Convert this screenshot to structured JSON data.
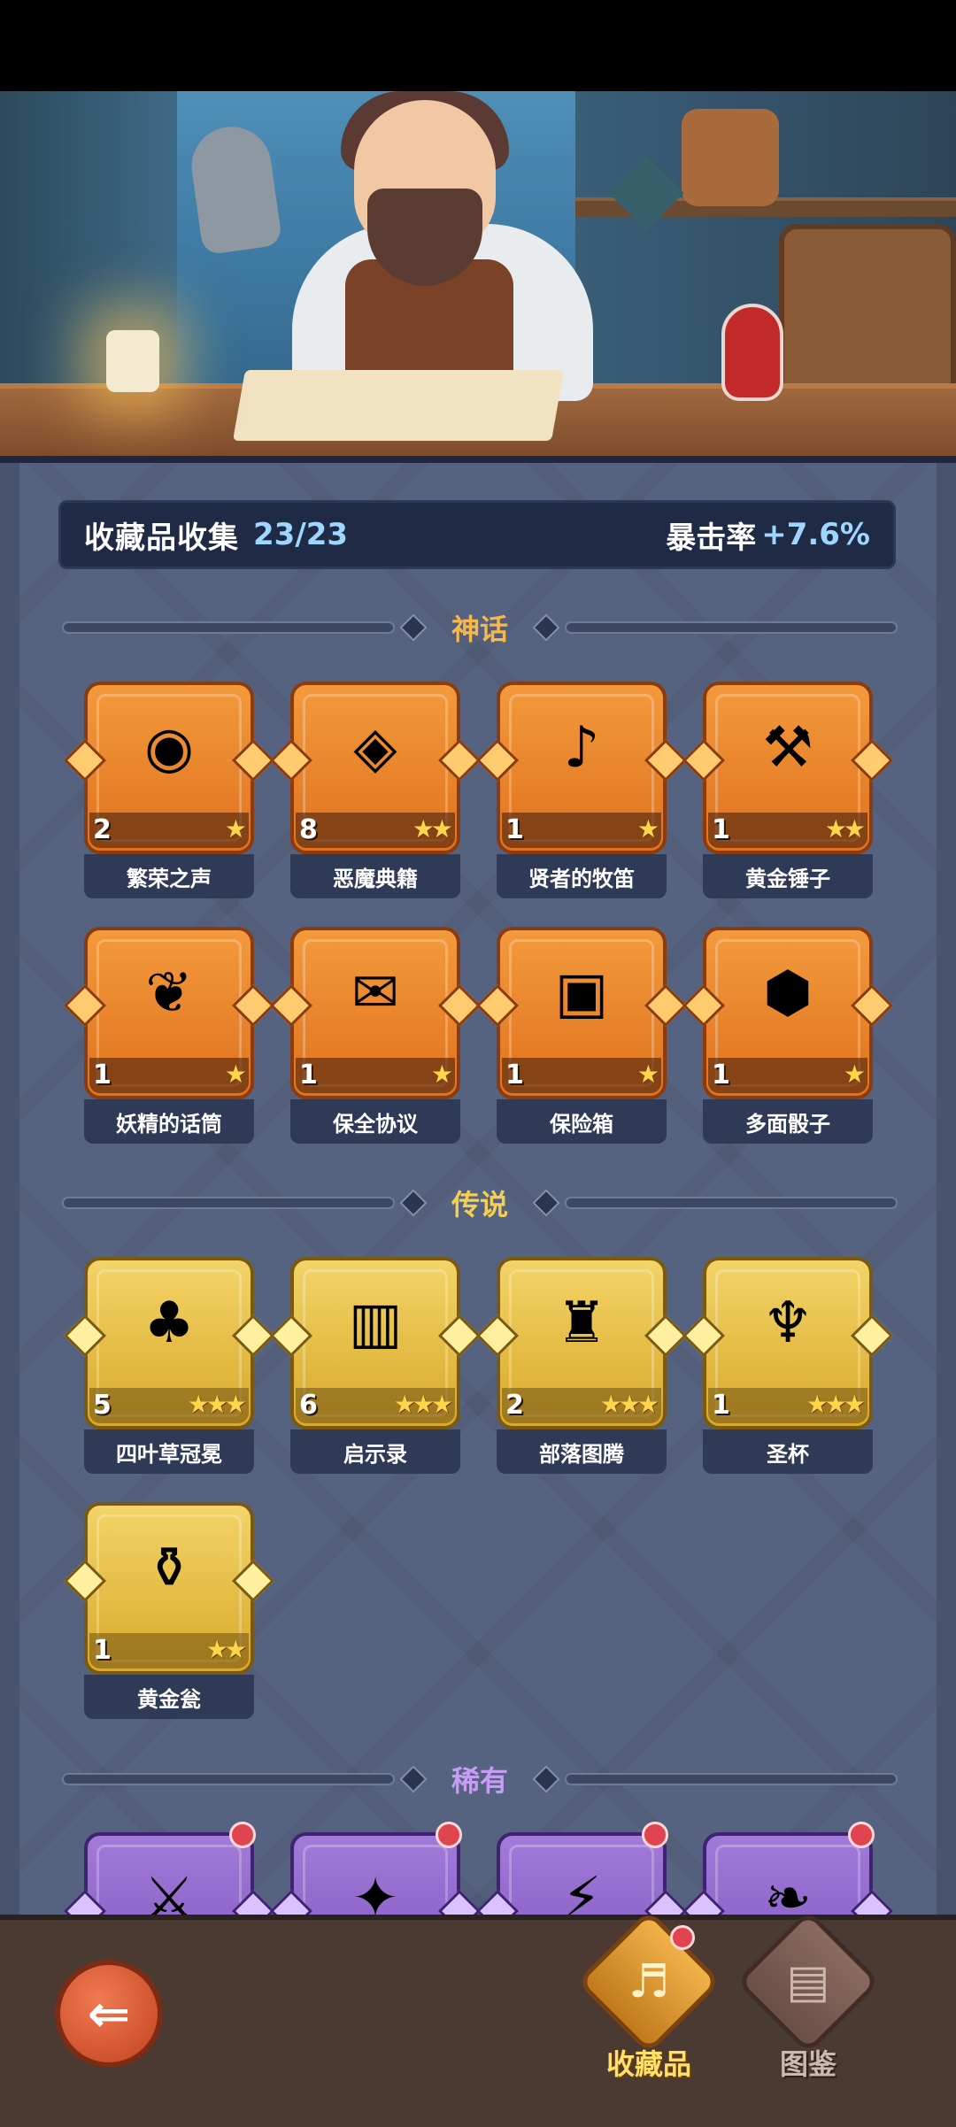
{
  "summary": {
    "label": "收藏品收集",
    "count": "23/23",
    "crit_label": "暴击率",
    "crit_value": "+7.6%"
  },
  "sections": {
    "mythic": {
      "title": "神话",
      "color": "#f6b84a"
    },
    "legendary": {
      "title": "传说",
      "color": "#f4cf52"
    },
    "rare": {
      "title": "稀有",
      "color": "#c79cf5"
    }
  },
  "mythic_items": [
    {
      "name": "繁荣之声",
      "level": "2",
      "stars": "★",
      "icon": "orb-icon"
    },
    {
      "name": "恶魔典籍",
      "level": "8",
      "stars": "★★",
      "icon": "eye-book-icon"
    },
    {
      "name": "贤者的牧笛",
      "level": "1",
      "stars": "★",
      "icon": "flute-icon"
    },
    {
      "name": "黄金锤子",
      "level": "1",
      "stars": "★★",
      "icon": "hammer-icon"
    },
    {
      "name": "妖精的话筒",
      "level": "1",
      "stars": "★",
      "icon": "fairy-icon"
    },
    {
      "name": "保全协议",
      "level": "1",
      "stars": "★",
      "icon": "scroll-icon"
    },
    {
      "name": "保险箱",
      "level": "1",
      "stars": "★",
      "icon": "safe-icon"
    },
    {
      "name": "多面骰子",
      "level": "1",
      "stars": "★",
      "icon": "dice-icon"
    }
  ],
  "legendary_items": [
    {
      "name": "四叶草冠冕",
      "level": "5",
      "stars": "★★★",
      "icon": "clover-crown-icon"
    },
    {
      "name": "启示录",
      "level": "6",
      "stars": "★★★",
      "icon": "open-book-icon"
    },
    {
      "name": "部落图腾",
      "level": "2",
      "stars": "★★★",
      "icon": "totem-icon"
    },
    {
      "name": "圣杯",
      "level": "1",
      "stars": "★★★",
      "icon": "chalice-icon"
    },
    {
      "name": "黄金瓮",
      "level": "1",
      "stars": "★★",
      "icon": "urn-icon"
    }
  ],
  "rare_items": [
    {
      "icon": "axe-icon"
    },
    {
      "icon": "feather-icon"
    },
    {
      "icon": "lightning-card-icon"
    },
    {
      "icon": "vine-icon"
    }
  ],
  "nav": {
    "collection_label": "收藏品",
    "codex_label": "图鉴",
    "back_icon": "back-arrow-icon"
  }
}
